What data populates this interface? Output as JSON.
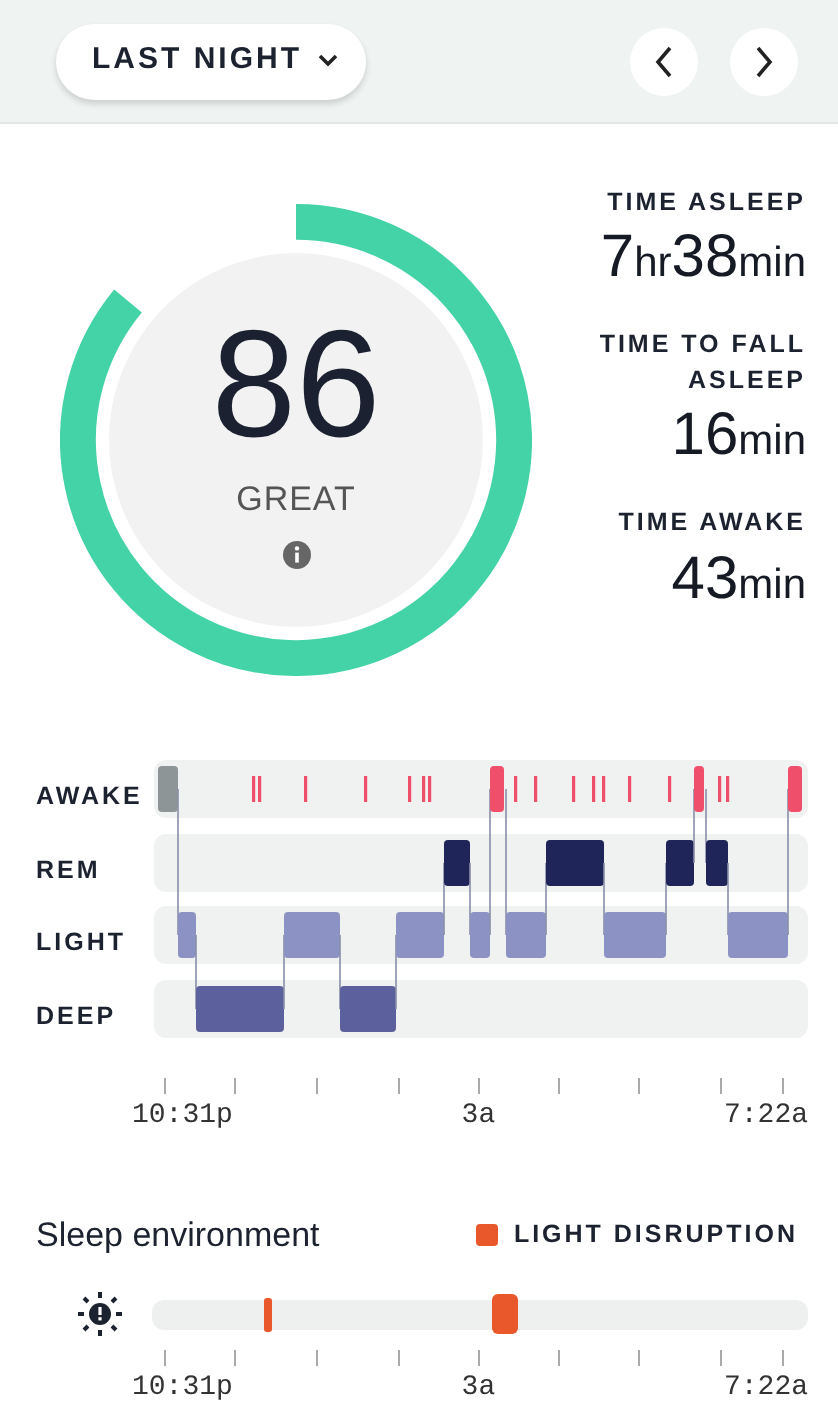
{
  "header": {
    "range_button": "LAST NIGHT"
  },
  "score": {
    "value": "86",
    "rating": "GREAT"
  },
  "stats": [
    {
      "label": "TIME ASLEEP",
      "parts": [
        {
          "text": "7",
          "kind": "number"
        },
        {
          "text": "hr",
          "kind": "unit"
        },
        {
          "text": "38",
          "kind": "number"
        },
        {
          "text": "min",
          "kind": "unit"
        }
      ]
    },
    {
      "label": "TIME TO FALL ASLEEP",
      "parts": [
        {
          "text": "16",
          "kind": "number"
        },
        {
          "text": "min",
          "kind": "unit"
        }
      ]
    },
    {
      "label": "TIME AWAKE",
      "parts": [
        {
          "text": "43",
          "kind": "number"
        },
        {
          "text": "min",
          "kind": "unit"
        }
      ]
    }
  ],
  "sleep_stages": {
    "rows": [
      "AWAKE",
      "REM",
      "LIGHT",
      "DEEP"
    ],
    "time_labels": [
      "10:31p",
      "3a",
      "7:22a"
    ]
  },
  "environment": {
    "title": "Sleep environment",
    "legend": "LIGHT DISRUPTION",
    "time_labels": [
      "10:31p",
      "3a",
      "7:22a"
    ]
  }
}
